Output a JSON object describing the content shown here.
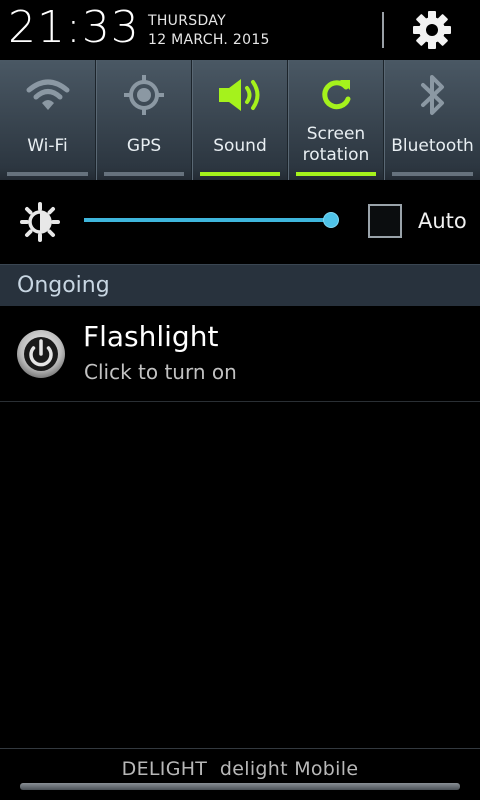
{
  "header": {
    "time": "21:33",
    "day": "THURSDAY",
    "date": "12 MARCH. 2015",
    "settings_icon": "gear-icon"
  },
  "toggles": [
    {
      "label": "Wi-Fi",
      "icon": "wifi-icon",
      "on": false
    },
    {
      "label": "GPS",
      "icon": "gps-icon",
      "on": false
    },
    {
      "label": "Sound",
      "icon": "speaker-icon",
      "on": true
    },
    {
      "label_line1": "Screen",
      "label_line2": "rotation",
      "icon": "rotation-icon",
      "on": true
    },
    {
      "label": "Bluetooth",
      "icon": "bluetooth-icon",
      "on": false
    }
  ],
  "brightness": {
    "icon": "brightness-icon",
    "level": 1.0,
    "auto_label": "Auto",
    "auto_checked": false
  },
  "section": {
    "title": "Ongoing"
  },
  "notification": {
    "title": "Flashlight",
    "subtitle": "Click to turn on",
    "icon": "power-icon"
  },
  "footer": {
    "carrier": "DELIGHT  delight Mobile"
  },
  "colors": {
    "accent_on": "#a5f21c",
    "slider": "#3fb6dc",
    "panel": "#3a4652"
  }
}
